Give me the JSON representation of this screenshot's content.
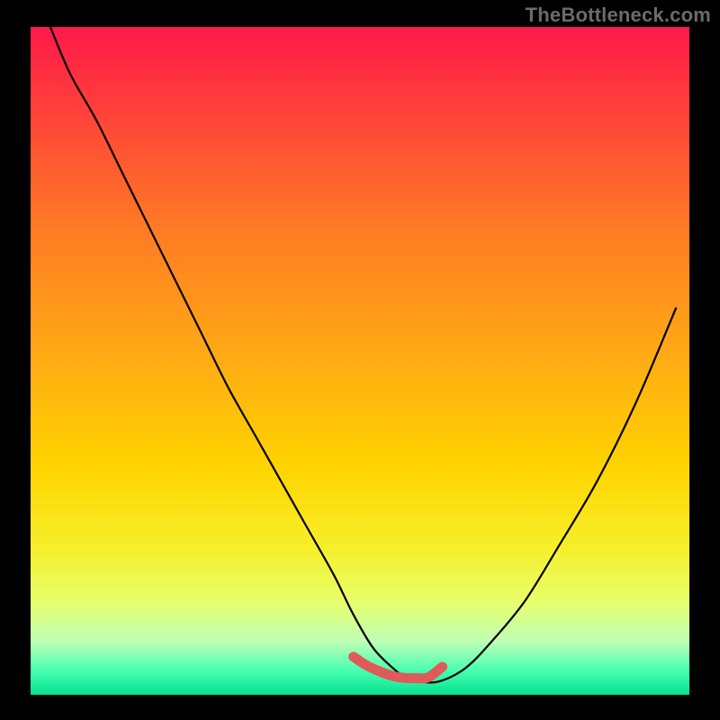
{
  "watermark": "TheBottleneck.com",
  "chart_data": {
    "type": "line",
    "title": "",
    "xlabel": "",
    "ylabel": "",
    "xlim": [
      0,
      100
    ],
    "ylim": [
      0,
      100
    ],
    "background_gradient": {
      "stops": [
        {
          "offset": 0.0,
          "color": "#ff194b"
        },
        {
          "offset": 0.12,
          "color": "#ff3f3a"
        },
        {
          "offset": 0.3,
          "color": "#ff7a24"
        },
        {
          "offset": 0.48,
          "color": "#ffa716"
        },
        {
          "offset": 0.66,
          "color": "#ffd400"
        },
        {
          "offset": 0.78,
          "color": "#f6ef2a"
        },
        {
          "offset": 0.86,
          "color": "#e8ff6b"
        },
        {
          "offset": 0.92,
          "color": "#bfffb6"
        },
        {
          "offset": 0.965,
          "color": "#44ffb0"
        },
        {
          "offset": 1.0,
          "color": "#05e08e"
        }
      ]
    },
    "series": [
      {
        "name": "bottleneck-curve",
        "color": "#000000",
        "x": [
          3,
          6,
          10,
          14,
          18,
          22,
          26,
          30,
          34,
          38,
          42,
          46,
          49,
          52,
          55,
          57,
          59,
          62,
          66,
          70,
          75,
          80,
          86,
          92,
          98
        ],
        "y": [
          100,
          93,
          86,
          78,
          70,
          62,
          54,
          46,
          39,
          32,
          25,
          18,
          12,
          7,
          4,
          2.5,
          2,
          2,
          4,
          8,
          14,
          22,
          32,
          44,
          58
        ]
      },
      {
        "name": "optimal-marker",
        "color": "#e05a5a",
        "type": "segment",
        "x": [
          49,
          51,
          53,
          55,
          57,
          58.5,
          60,
          61,
          62.5
        ],
        "y": [
          5.7,
          4.4,
          3.5,
          2.8,
          2.5,
          2.5,
          2.5,
          3.0,
          4.2
        ]
      }
    ],
    "optimal_range_pct": [
      49,
      62.5
    ]
  }
}
